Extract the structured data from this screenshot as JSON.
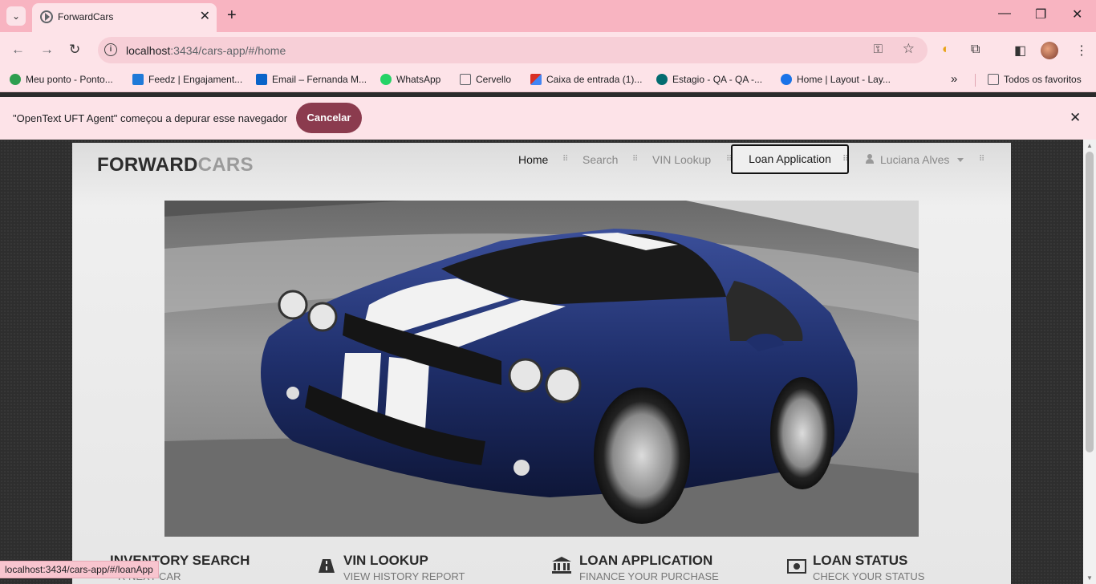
{
  "browser": {
    "tab_title": "ForwardCars",
    "url_host": "localhost",
    "url_path": ":3434/cars-app/#/home",
    "bookmarks": [
      {
        "label": "Meu ponto - Ponto...",
        "color": "#2e9e4f"
      },
      {
        "label": "Feedz | Engajament...",
        "color": "#1f7ad8"
      },
      {
        "label": "Email – Fernanda M...",
        "color": "#0a64c9"
      },
      {
        "label": "WhatsApp",
        "color": "#25d366"
      },
      {
        "label": "Cervello",
        "color": "#5f6368"
      },
      {
        "label": "Caixa de entrada (1)...",
        "color": "#d93025"
      },
      {
        "label": "Estagio - QA - QA -...",
        "color": "#036c70"
      },
      {
        "label": "Home | Layout - Lay...",
        "color": "#1a73e8"
      }
    ],
    "more_bookmarks": "»",
    "all_bookmarks": "Todos os favoritos",
    "infobar_text": "\"OpenText UFT Agent\" começou a depurar esse navegador",
    "infobar_cancel": "Cancelar",
    "status_url": "localhost:3434/cars-app/#/loanApp"
  },
  "site": {
    "logo_a": "FORWARD",
    "logo_b": "CARS",
    "nav": {
      "home": "Home",
      "search": "Search",
      "vin": "VIN Lookup",
      "loan": "Loan Application",
      "user": "Luciana Alves"
    },
    "features": [
      {
        "title": "INVENTORY SEARCH",
        "subtitle": "R NEXT CAR",
        "icon": "search-icon"
      },
      {
        "title": "VIN LOOKUP",
        "subtitle": "VIEW HISTORY REPORT",
        "icon": "road-icon"
      },
      {
        "title": "LOAN APPLICATION",
        "subtitle": "FINANCE YOUR PURCHASE",
        "icon": "bank-icon"
      },
      {
        "title": "LOAN STATUS",
        "subtitle": "CHECK YOUR STATUS",
        "icon": "money-icon"
      }
    ]
  },
  "colors": {
    "tabbar": "#f8b4c1",
    "chrome": "#fde3e8",
    "cancel_button": "#8b3b4e",
    "car_body": "#1f2f6b"
  }
}
